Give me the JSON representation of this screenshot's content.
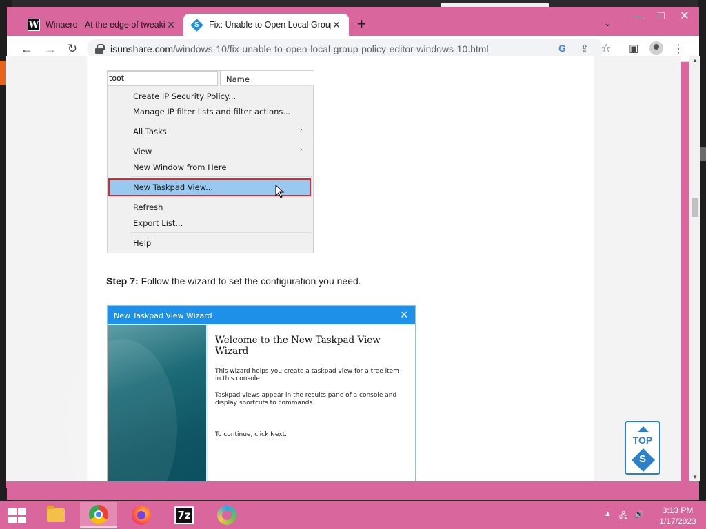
{
  "tabs": [
    {
      "label": "Winaero - At the edge of tweaking",
      "favicon": "W",
      "active": false
    },
    {
      "label": "Fix: Unable to Open Local Group Policy Editor",
      "favicon": "S",
      "active": true
    }
  ],
  "toolbar": {
    "url_domain": "isunshare.com",
    "url_path": "/windows-10/fix-unable-to-open-local-group-policy-editor-windows-10.html"
  },
  "screenshot1": {
    "tree_input": "toot",
    "column_header": "Name",
    "menu_items": [
      "Create IP Security Policy...",
      "Manage IP filter lists and filter actions...",
      "All Tasks",
      "View",
      "New Window from Here",
      "New Taskpad View...",
      "Refresh",
      "Export List...",
      "Help"
    ],
    "highlighted_item": "New Taskpad View..."
  },
  "step": {
    "label": "Step 7:",
    "text": " Follow the wizard to set the configuration you need."
  },
  "wizard": {
    "title": "New Taskpad View Wizard",
    "heading": "Welcome to the New Taskpad View Wizard",
    "para1": "This wizard helps you create a taskpad view for a tree item in this console.",
    "para2": "Taskpad views appear in the results pane of a console and display shortcuts to commands.",
    "para3": "To continue, click Next."
  },
  "top_button": {
    "label": "TOP",
    "logo": "S"
  },
  "taskbar": {
    "apps": [
      "file-explorer",
      "chrome",
      "firefox",
      "7-zip",
      "other-app"
    ],
    "time": "3:13 PM",
    "date": "1/17/2023"
  },
  "colors": {
    "accent": "#d9669d",
    "link_blue": "#2c7fc9",
    "highlight_border": "#e0262a",
    "menu_highlight": "#99c9ef"
  }
}
